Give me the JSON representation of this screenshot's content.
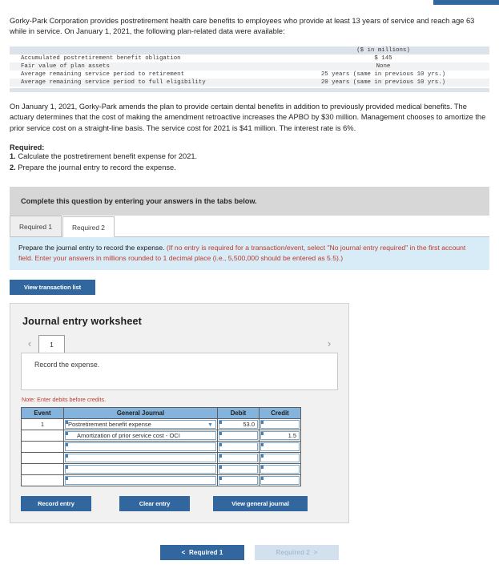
{
  "top_strip_color": "#31679e",
  "intro": {
    "paragraph1": "Gorky-Park Corporation provides postretirement health care benefits to employees who provide at least 13 years of service and reach age 63 while in service. On January 1, 2021, the following plan-related data were available:",
    "paragraph2": "On January 1, 2021, Gorky-Park amends the plan to provide certain dental benefits in addition to previously provided medical benefits. The actuary determines that the cost of making the amendment retroactive increases the APBO by $30 million. Management chooses to amortize the prior service cost on a straight-line basis. The service cost for 2021 is $41 million. The interest rate is 6%."
  },
  "data_table": {
    "value_header": "($ in millions)",
    "rows": [
      {
        "label": "Accumulated postretirement benefit obligation",
        "value": "$ 145"
      },
      {
        "label": "Fair value of plan assets",
        "value": "None"
      },
      {
        "label": "Average remaining service period to retirement",
        "value": "25 years (same in previous 10 yrs.)"
      },
      {
        "label": "Average remaining service period to full eligibility",
        "value": "20 years (same in previous 10 yrs.)"
      }
    ]
  },
  "required": {
    "heading": "Required:",
    "item1_num": "1.",
    "item1_text": "Calculate the postretirement benefit expense for 2021.",
    "item2_num": "2.",
    "item2_text": "Prepare the journal entry to record the expense."
  },
  "grey_bar": {
    "text": "Complete this question by entering your answers in the tabs below."
  },
  "tabs": [
    {
      "label": "Required 1",
      "active": false
    },
    {
      "label": "Required 2",
      "active": true
    }
  ],
  "info_banner": {
    "black_text": "Prepare the journal entry to record the expense.",
    "red_text": "(If no entry is required for a transaction/event, select \"No journal entry required\" in the first account field. Enter your answers in millions rounded to 1 decimal place (i.e., 5,500,000 should be entered as 5.5).)"
  },
  "view_transaction_list_label": "View transaction list",
  "worksheet": {
    "title": "Journal entry worksheet",
    "prev_icon": "chevron-left-icon",
    "next_icon": "chevron-right-icon",
    "page_number": "1",
    "instruction": "Record the expense.",
    "note": "Note: Enter debits before credits.",
    "columns": [
      "Event",
      "General Journal",
      "Debit",
      "Credit"
    ],
    "rows": [
      {
        "event": "1",
        "account": "Postretirement benefit expense",
        "indent": false,
        "dropdown": true,
        "debit": "53.0",
        "credit": ""
      },
      {
        "event": "",
        "account": "Amortization of prior service cost - OCI",
        "indent": true,
        "dropdown": false,
        "debit": "",
        "credit": "1.5"
      },
      {
        "event": "",
        "account": "",
        "indent": false,
        "dropdown": false,
        "debit": "",
        "credit": ""
      },
      {
        "event": "",
        "account": "",
        "indent": false,
        "dropdown": false,
        "debit": "",
        "credit": ""
      },
      {
        "event": "",
        "account": "",
        "indent": false,
        "dropdown": false,
        "debit": "",
        "credit": ""
      },
      {
        "event": "",
        "account": "",
        "indent": false,
        "dropdown": false,
        "debit": "",
        "credit": ""
      }
    ],
    "buttons": {
      "record": "Record entry",
      "clear": "Clear entry",
      "view_general_journal": "View general journal"
    }
  },
  "footer_nav": {
    "prev_arrow": "<",
    "prev_label": "Required 1",
    "next_label": "Required 2",
    "next_arrow": ">"
  }
}
